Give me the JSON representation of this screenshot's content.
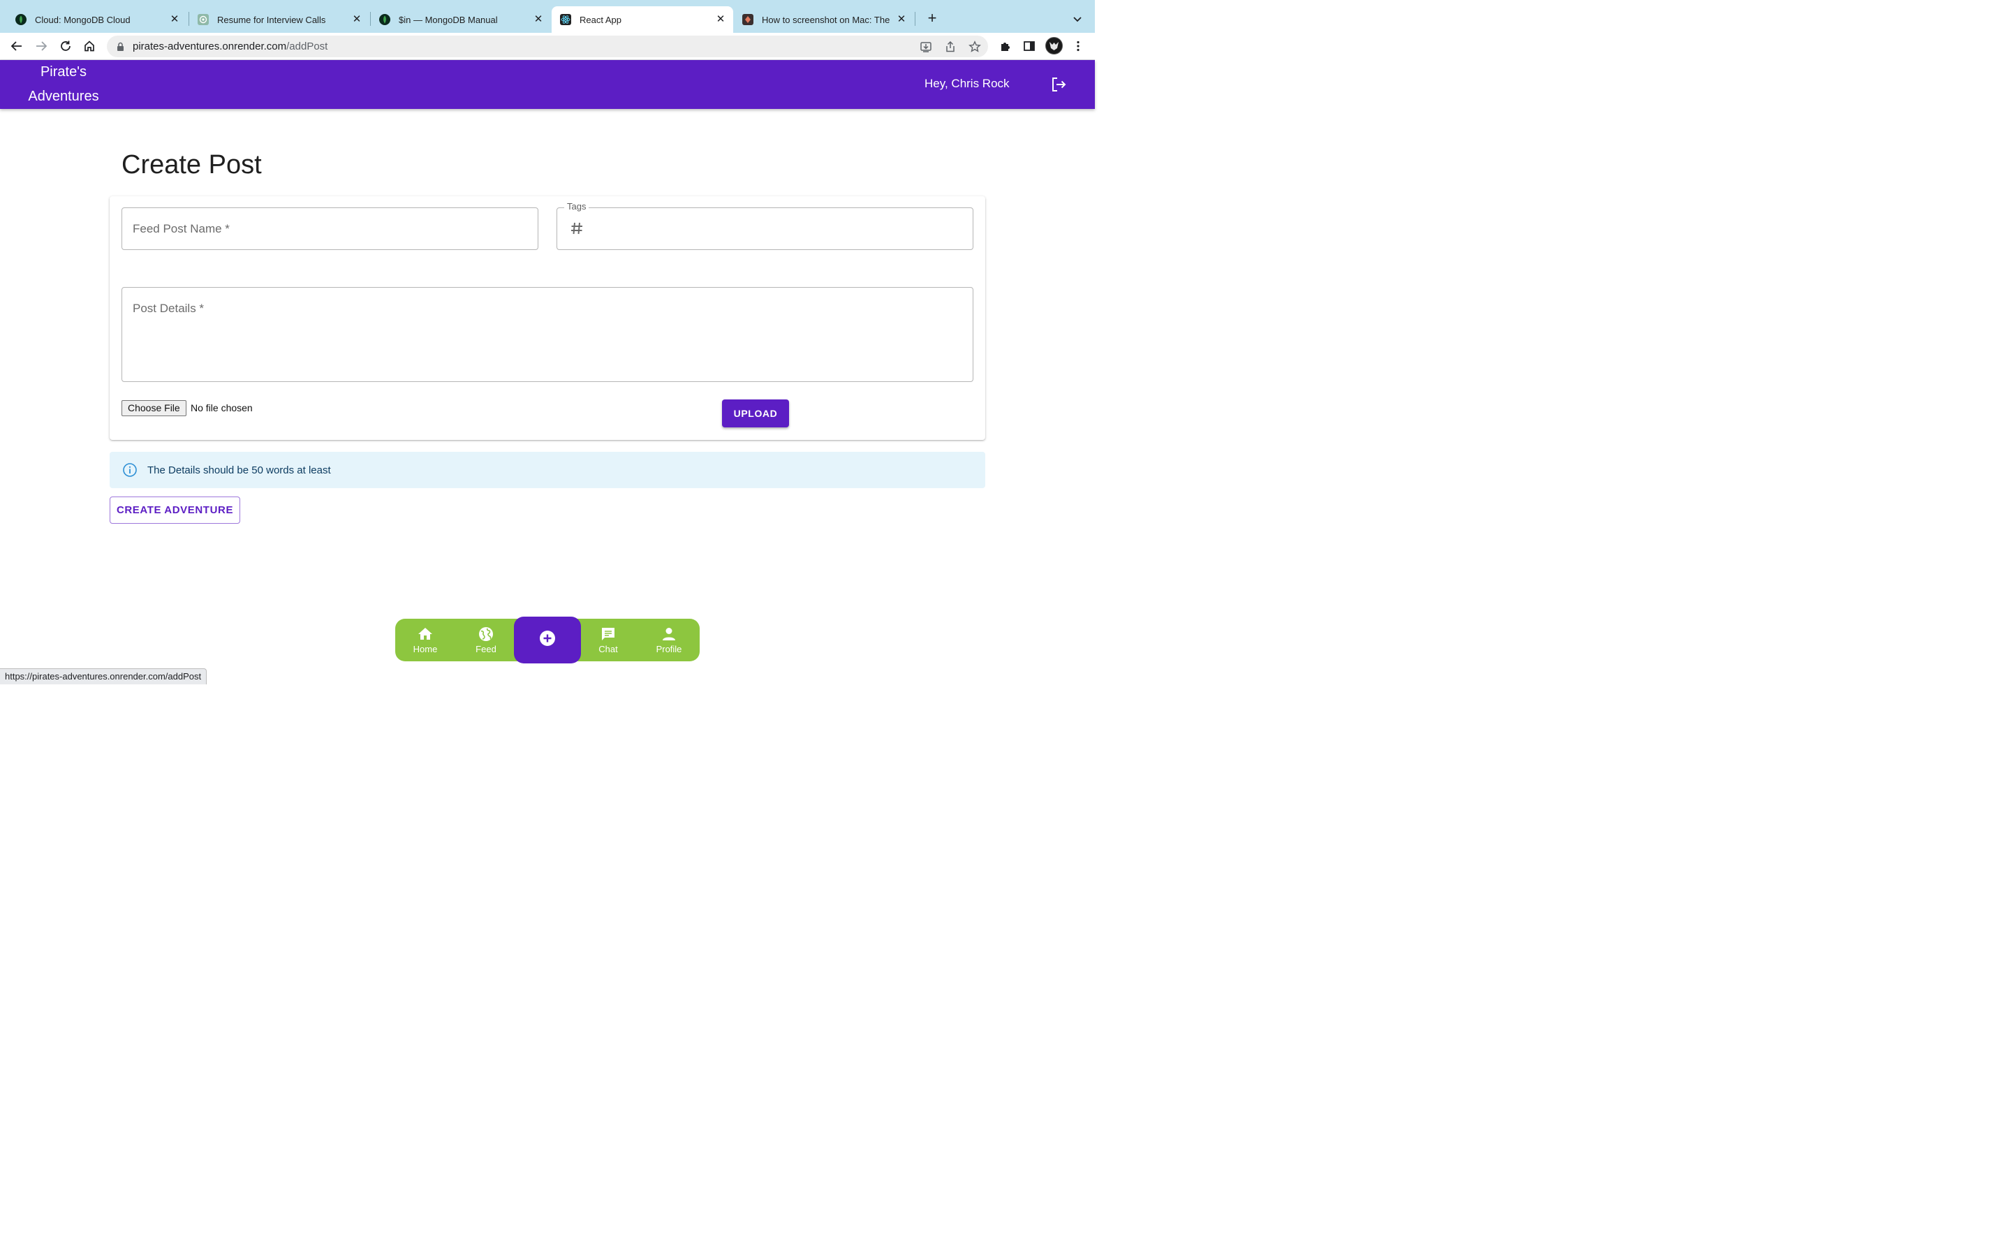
{
  "browser": {
    "tabs": [
      {
        "title": "Cloud: MongoDB Cloud",
        "icon": "mongodb-leaf-icon",
        "active": false
      },
      {
        "title": "Resume for Interview Calls",
        "icon": "openai-icon",
        "active": false
      },
      {
        "title": "$in — MongoDB Manual",
        "icon": "mongodb-leaf-icon",
        "active": false
      },
      {
        "title": "React App",
        "icon": "react-icon",
        "active": true
      },
      {
        "title": "How to screenshot on Mac: The",
        "icon": "site-icon",
        "active": false
      }
    ],
    "url_host": "pirates-adventures.onrender.com",
    "url_path": "/addPost",
    "status_url": "https://pirates-adventures.onrender.com/addPost"
  },
  "header": {
    "brand_line1": "Pirate's",
    "brand_line2": "Adventures",
    "greeting": "Hey, Chris Rock",
    "color": "#5c1ec4"
  },
  "page": {
    "title": "Create Post"
  },
  "form": {
    "post_name_placeholder": "Feed Post Name *",
    "tags_label": "Tags",
    "details_placeholder": "Post Details *",
    "file_button": "Choose File",
    "file_status": "No file chosen",
    "upload_label": "UPLOAD"
  },
  "alert": {
    "text": "The Details should be 50 words at least",
    "color": "#e5f4fb"
  },
  "actions": {
    "create_label": "CREATE ADVENTURE"
  },
  "bottom_nav": {
    "color": "#8dc63f",
    "items": [
      {
        "label": "Home",
        "icon": "home-icon"
      },
      {
        "label": "Feed",
        "icon": "globe-icon"
      },
      {
        "label": "",
        "icon": "add-circle-icon"
      },
      {
        "label": "Chat",
        "icon": "chat-icon"
      },
      {
        "label": "Profile",
        "icon": "person-icon"
      }
    ]
  }
}
